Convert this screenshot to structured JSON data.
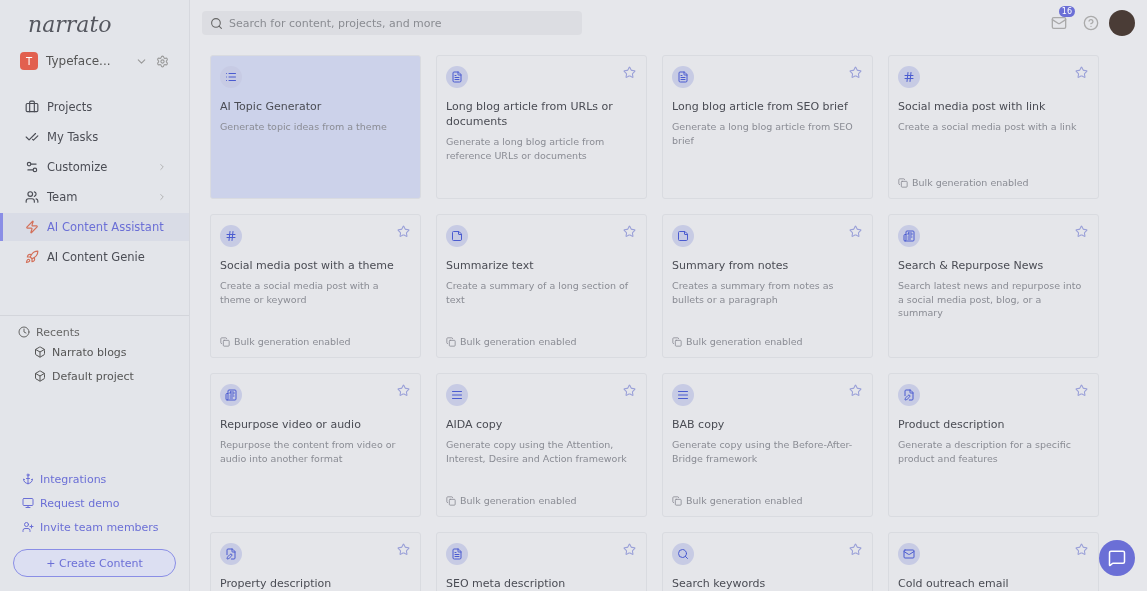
{
  "logo": "narrato",
  "workspace": {
    "initial": "T",
    "name": "Typeface..."
  },
  "nav": [
    {
      "label": "Projects",
      "selected": false,
      "submenu": false
    },
    {
      "label": "My Tasks",
      "selected": false,
      "submenu": false
    },
    {
      "label": "Customize",
      "selected": false,
      "submenu": true
    },
    {
      "label": "Team",
      "selected": false,
      "submenu": true
    },
    {
      "label": "AI Content Assistant",
      "selected": true,
      "submenu": false
    },
    {
      "label": "AI Content Genie",
      "selected": false,
      "submenu": false
    }
  ],
  "recents": {
    "title": "Recents",
    "items": [
      "Narrato blogs",
      "Default project"
    ]
  },
  "footer_links": [
    "Integrations",
    "Request demo",
    "Invite team members"
  ],
  "create_button": "+ Create Content",
  "search": {
    "placeholder": "Search for content, projects, and more"
  },
  "notifications": "16",
  "cards": [
    {
      "title": "AI Topic Generator",
      "description": "Generate topic ideas from a theme",
      "selected": true
    },
    {
      "title": "Long blog article from URLs or documents",
      "description": "Generate a long blog article from reference URLs or documents",
      "selected": false
    },
    {
      "title": "Long blog article from SEO brief",
      "description": "Generate a long blog article from SEO brief",
      "selected": false
    },
    {
      "title": "Social media post with link",
      "description": "Create a social media post with a link",
      "bulk_note": "Bulk generation enabled",
      "selected": false
    },
    {
      "title": "Social media post with a theme",
      "description": "Create a social media post with a theme or keyword",
      "bulk_note": "Bulk generation enabled",
      "selected": false
    },
    {
      "title": "Summarize text",
      "description": "Create a summary of a long section of text",
      "bulk_note": "Bulk generation enabled",
      "selected": false
    },
    {
      "title": "Summary from notes",
      "description": "Creates a summary from notes as bullets or a paragraph",
      "bulk_note": "Bulk generation enabled",
      "selected": false
    },
    {
      "title": "Search & Repurpose News",
      "description": "Search latest news and repurpose into a social media post, blog, or a summary",
      "selected": false
    },
    {
      "title": "Repurpose video or audio",
      "description": "Repurpose the content from video or audio into another format",
      "selected": false
    },
    {
      "title": "AIDA copy",
      "description": "Generate copy using the Attention, Interest, Desire and Action framework",
      "bulk_note": "Bulk generation enabled",
      "selected": false
    },
    {
      "title": "BAB copy",
      "description": "Generate copy using the Before-After-Bridge framework",
      "bulk_note": "Bulk generation enabled",
      "selected": false
    },
    {
      "title": "Product description",
      "description": "Generate a description for a specific product and features",
      "selected": false
    },
    {
      "title": "Property description",
      "selected": false
    },
    {
      "title": "SEO meta description",
      "selected": false
    },
    {
      "title": "Search keywords",
      "selected": false
    },
    {
      "title": "Cold outreach email",
      "selected": false
    }
  ]
}
